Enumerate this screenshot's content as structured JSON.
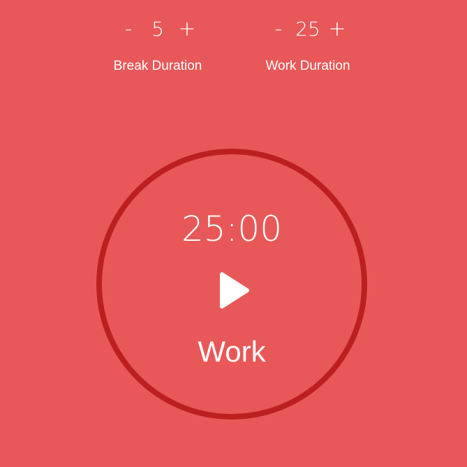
{
  "break": {
    "decrement_label": "-",
    "value": "5",
    "increment_label": "+",
    "label": "Break Duration"
  },
  "work": {
    "decrement_label": "-",
    "value": "25",
    "increment_label": "+",
    "label": "Work Duration"
  },
  "timer": {
    "time": "25:00",
    "mode": "Work",
    "play_icon": "play-icon"
  },
  "colors": {
    "background": "#E85858",
    "ring": "#BC1F1F",
    "text": "#FFFFFF"
  }
}
